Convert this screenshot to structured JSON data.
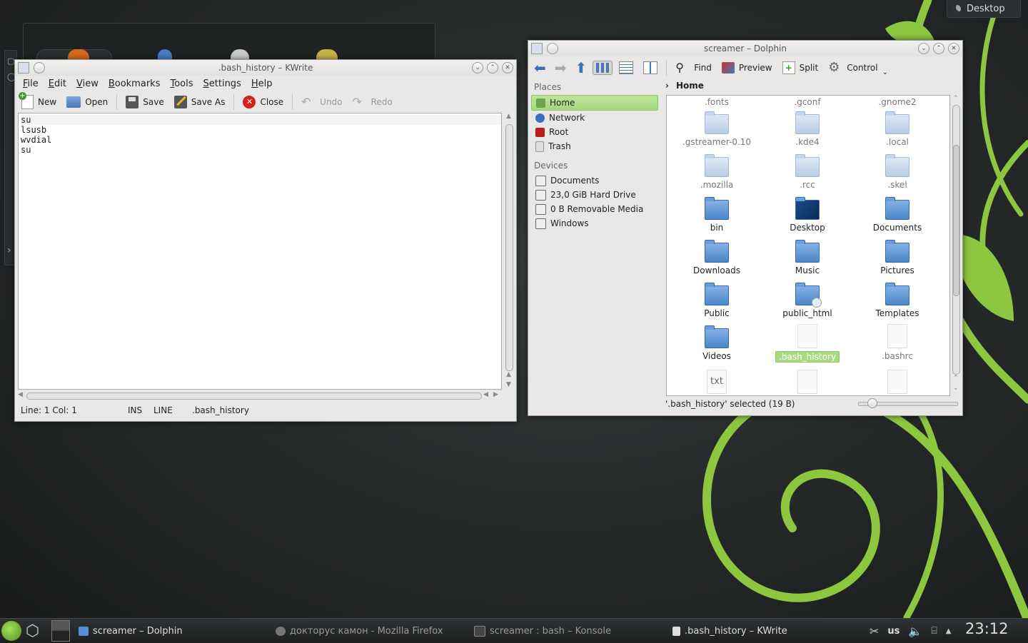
{
  "desktop": {
    "button_label": "Desktop"
  },
  "kwrite": {
    "title": ".bash_history – KWrite",
    "menu": [
      "File",
      "Edit",
      "View",
      "Bookmarks",
      "Tools",
      "Settings",
      "Help"
    ],
    "toolbar": {
      "new": "New",
      "open": "Open",
      "save": "Save",
      "save_as": "Save As",
      "close": "Close",
      "undo": "Undo",
      "redo": "Redo"
    },
    "lines": [
      "su",
      "lsusb",
      "wvdial",
      "su"
    ],
    "status": {
      "position": "Line: 1 Col: 1",
      "mode": "INS",
      "sel": "LINE",
      "file": ".bash_history"
    }
  },
  "dolphin": {
    "title": "screamer – Dolphin",
    "toolbar": {
      "find": "Find",
      "preview": "Preview",
      "split": "Split",
      "control": "Control"
    },
    "places_header": "Places",
    "places": [
      "Home",
      "Network",
      "Root",
      "Trash"
    ],
    "devices_header": "Devices",
    "devices": [
      "Documents",
      "23,0 GiB Hard Drive",
      "0 B Removable Media",
      "Windows"
    ],
    "breadcrumb": "Home",
    "files": [
      ".fonts",
      ".gconf",
      ".gnome2",
      ".gstreamer-0.10",
      ".kde4",
      ".local",
      ".mozilla",
      ".rcc",
      ".skel",
      "bin",
      "Desktop",
      "Documents",
      "Downloads",
      "Music",
      "Pictures",
      "Public",
      "public_html",
      "Templates",
      "Videos",
      ".bash_history",
      ".bashrc"
    ],
    "bottom_row_icon": "txt",
    "status": "'.bash_history' selected (19 B)"
  },
  "taskbar": {
    "tasks": [
      "screamer – Dolphin",
      "докторус камон - Mozilla Firefox",
      "screamer : bash – Konsole",
      ".bash_history – KWrite"
    ],
    "keyboard": "us",
    "clock": "23:12"
  },
  "colors": {
    "accent_green": "#8dc63f",
    "selection": "#a9d980",
    "folder_blue": "#4a86c8"
  }
}
